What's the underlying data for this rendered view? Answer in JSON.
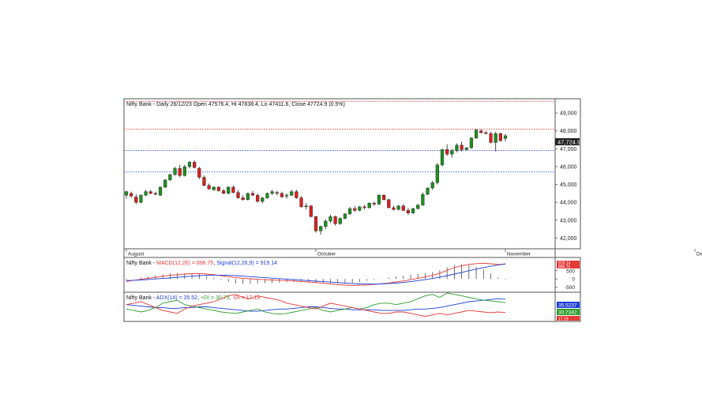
{
  "chart_data": [
    {
      "type": "candlestick",
      "title": "Nifty Bank - Daily 26/12/23 Open 47576.4, Hi 47838.4, Lo 47411.6, Close 47724.9 (0.5%)",
      "y_ticks": [
        42000,
        43000,
        44000,
        45000,
        46000,
        47000,
        48000,
        49000
      ],
      "y_tick_labels": [
        "42,000",
        "43,000",
        "44,000",
        "45,000",
        "46,000",
        "47,000",
        "48,000",
        "49,000"
      ],
      "ylim": [
        41400,
        49800
      ],
      "x_labels": [
        {
          "label": "August",
          "index": 0
        },
        {
          "label": "October",
          "index": 39
        },
        {
          "label": "November",
          "index": 78
        },
        {
          "label": "December",
          "index": 117
        }
      ],
      "last_value_label": "47,724.9",
      "horizontal_lines": [
        {
          "value": 49650,
          "color": "#e53935"
        },
        {
          "value": 48100,
          "color": "#e53935"
        },
        {
          "value": 46900,
          "color": "#1e3fd8"
        },
        {
          "value": 45700,
          "color": "#1e3fd8"
        }
      ],
      "candles": [
        {
          "o": 44400,
          "h": 44650,
          "l": 44200,
          "c": 44600
        },
        {
          "o": 44500,
          "h": 44600,
          "l": 44250,
          "c": 44350
        },
        {
          "o": 44300,
          "h": 44450,
          "l": 43900,
          "c": 44000
        },
        {
          "o": 44000,
          "h": 44450,
          "l": 43950,
          "c": 44400
        },
        {
          "o": 44400,
          "h": 44700,
          "l": 44350,
          "c": 44600
        },
        {
          "o": 44600,
          "h": 44700,
          "l": 44450,
          "c": 44500
        },
        {
          "o": 44500,
          "h": 44600,
          "l": 44400,
          "c": 44450
        },
        {
          "o": 44400,
          "h": 44900,
          "l": 44350,
          "c": 44850
        },
        {
          "o": 44850,
          "h": 45300,
          "l": 44800,
          "c": 45250
        },
        {
          "o": 45250,
          "h": 45600,
          "l": 45200,
          "c": 45550
        },
        {
          "o": 45550,
          "h": 46000,
          "l": 45500,
          "c": 45900
        },
        {
          "o": 45900,
          "h": 46100,
          "l": 45400,
          "c": 45500
        },
        {
          "o": 45500,
          "h": 46100,
          "l": 45450,
          "c": 46000
        },
        {
          "o": 46000,
          "h": 46300,
          "l": 45900,
          "c": 46250
        },
        {
          "o": 46250,
          "h": 46350,
          "l": 45900,
          "c": 45950
        },
        {
          "o": 45900,
          "h": 46000,
          "l": 45300,
          "c": 45400
        },
        {
          "o": 45400,
          "h": 45500,
          "l": 44900,
          "c": 44950
        },
        {
          "o": 44950,
          "h": 45050,
          "l": 44700,
          "c": 44750
        },
        {
          "o": 44700,
          "h": 44900,
          "l": 44650,
          "c": 44850
        },
        {
          "o": 44850,
          "h": 44900,
          "l": 44600,
          "c": 44650
        },
        {
          "o": 44650,
          "h": 44750,
          "l": 44450,
          "c": 44500
        },
        {
          "o": 44500,
          "h": 44900,
          "l": 44450,
          "c": 44850
        },
        {
          "o": 44850,
          "h": 44950,
          "l": 44500,
          "c": 44550
        },
        {
          "o": 44550,
          "h": 44700,
          "l": 44200,
          "c": 44250
        },
        {
          "o": 44250,
          "h": 44400,
          "l": 44100,
          "c": 44150
        },
        {
          "o": 44150,
          "h": 44550,
          "l": 44100,
          "c": 44500
        },
        {
          "o": 44500,
          "h": 44650,
          "l": 44350,
          "c": 44400
        },
        {
          "o": 44400,
          "h": 44500,
          "l": 44000,
          "c": 44050
        },
        {
          "o": 44050,
          "h": 44300,
          "l": 43950,
          "c": 44250
        },
        {
          "o": 44250,
          "h": 44550,
          "l": 44200,
          "c": 44500
        },
        {
          "o": 44500,
          "h": 44700,
          "l": 44400,
          "c": 44600
        },
        {
          "o": 44550,
          "h": 44650,
          "l": 44400,
          "c": 44500
        },
        {
          "o": 44500,
          "h": 44600,
          "l": 44250,
          "c": 44300
        },
        {
          "o": 44350,
          "h": 44500,
          "l": 44200,
          "c": 44400
        },
        {
          "o": 44400,
          "h": 44700,
          "l": 44350,
          "c": 44600
        },
        {
          "o": 44600,
          "h": 44700,
          "l": 44200,
          "c": 44250
        },
        {
          "o": 44250,
          "h": 44350,
          "l": 43700,
          "c": 43750
        },
        {
          "o": 43750,
          "h": 43950,
          "l": 43600,
          "c": 43800
        },
        {
          "o": 43800,
          "h": 43850,
          "l": 43150,
          "c": 43200
        },
        {
          "o": 43200,
          "h": 43250,
          "l": 42300,
          "c": 42400
        },
        {
          "o": 42400,
          "h": 42700,
          "l": 42200,
          "c": 42650
        },
        {
          "o": 42650,
          "h": 43050,
          "l": 42500,
          "c": 42950
        },
        {
          "o": 42950,
          "h": 43300,
          "l": 42850,
          "c": 43200
        },
        {
          "o": 43200,
          "h": 43250,
          "l": 42700,
          "c": 42800
        },
        {
          "o": 42800,
          "h": 43150,
          "l": 42750,
          "c": 43100
        },
        {
          "o": 43100,
          "h": 43400,
          "l": 43050,
          "c": 43350
        },
        {
          "o": 43350,
          "h": 43750,
          "l": 43300,
          "c": 43650
        },
        {
          "o": 43650,
          "h": 43800,
          "l": 43450,
          "c": 43550
        },
        {
          "o": 43550,
          "h": 43800,
          "l": 43500,
          "c": 43750
        },
        {
          "o": 43750,
          "h": 43850,
          "l": 43600,
          "c": 43700
        },
        {
          "o": 43700,
          "h": 44000,
          "l": 43650,
          "c": 43950
        },
        {
          "o": 43950,
          "h": 44050,
          "l": 43800,
          "c": 43900
        },
        {
          "o": 43900,
          "h": 44450,
          "l": 43850,
          "c": 44400
        },
        {
          "o": 44400,
          "h": 44450,
          "l": 44100,
          "c": 44150
        },
        {
          "o": 44150,
          "h": 44200,
          "l": 43650,
          "c": 43700
        },
        {
          "o": 43700,
          "h": 43800,
          "l": 43550,
          "c": 43600
        },
        {
          "o": 43600,
          "h": 43850,
          "l": 43550,
          "c": 43800
        },
        {
          "o": 43800,
          "h": 43900,
          "l": 43500,
          "c": 43550
        },
        {
          "o": 43550,
          "h": 43700,
          "l": 43300,
          "c": 43400
        },
        {
          "o": 43400,
          "h": 43700,
          "l": 43350,
          "c": 43650
        },
        {
          "o": 43650,
          "h": 43900,
          "l": 43600,
          "c": 43850
        },
        {
          "o": 43850,
          "h": 44550,
          "l": 43800,
          "c": 44450
        },
        {
          "o": 44450,
          "h": 44850,
          "l": 44400,
          "c": 44800
        },
        {
          "o": 44800,
          "h": 45200,
          "l": 44700,
          "c": 45100
        },
        {
          "o": 45100,
          "h": 46200,
          "l": 45000,
          "c": 46100
        },
        {
          "o": 46100,
          "h": 47000,
          "l": 46000,
          "c": 46950
        },
        {
          "o": 46950,
          "h": 47250,
          "l": 46600,
          "c": 46700
        },
        {
          "o": 46700,
          "h": 47000,
          "l": 46500,
          "c": 46900
        },
        {
          "o": 46900,
          "h": 47300,
          "l": 46800,
          "c": 47200
        },
        {
          "o": 47200,
          "h": 47400,
          "l": 46850,
          "c": 46950
        },
        {
          "o": 46950,
          "h": 47100,
          "l": 46900,
          "c": 47050
        },
        {
          "o": 47050,
          "h": 47650,
          "l": 47000,
          "c": 47600
        },
        {
          "o": 47600,
          "h": 48100,
          "l": 47550,
          "c": 48050
        },
        {
          "o": 48000,
          "h": 48100,
          "l": 47850,
          "c": 47900
        },
        {
          "o": 47900,
          "h": 48000,
          "l": 47800,
          "c": 47850
        },
        {
          "o": 47850,
          "h": 47950,
          "l": 47300,
          "c": 47350
        },
        {
          "o": 47350,
          "h": 47950,
          "l": 46850,
          "c": 47850
        },
        {
          "o": 47850,
          "h": 47900,
          "l": 47400,
          "c": 47450
        },
        {
          "o": 47576.4,
          "h": 47838.4,
          "l": 47411.6,
          "c": 47724.9
        }
      ]
    },
    {
      "type": "line",
      "title": "Nifty Bank - MACD(12,26) = 896.75, Signal(12,26,9) = 919.14",
      "title_parts": [
        "Nifty Bank - ",
        "MACD(12,26) = 896.75",
        ", ",
        "Signal(12,26,9) = 919.14"
      ],
      "y_ticks": [
        -500,
        0,
        500
      ],
      "y_tick_labels": [
        "-500",
        "0",
        "500"
      ],
      "ylim": [
        -800,
        1300
      ],
      "value_flags": [
        "919.14",
        "896.75"
      ],
      "series": [
        {
          "name": "MACD(12,26)",
          "color": "#e53935",
          "values": [
            -150,
            -80,
            -20,
            40,
            100,
            160,
            220,
            260,
            300,
            320,
            330,
            300,
            260,
            200,
            140,
            80,
            40,
            10,
            -20,
            -40,
            -60,
            -80,
            -100,
            -120,
            -150,
            -180,
            -220,
            -260,
            -300,
            -340,
            -370,
            -390,
            -380,
            -360,
            -330,
            -290,
            -240,
            -180,
            -120,
            -40,
            40,
            120,
            220,
            350,
            520,
            680,
            800,
            880,
            930,
            950,
            920,
            880,
            896.75
          ]
        },
        {
          "name": "Signal(12,26,9)",
          "color": "#1e3fd8",
          "values": [
            -100,
            -80,
            -60,
            -30,
            0,
            30,
            60,
            100,
            140,
            170,
            200,
            220,
            230,
            230,
            220,
            200,
            170,
            140,
            110,
            80,
            50,
            20,
            -10,
            -40,
            -70,
            -100,
            -130,
            -160,
            -190,
            -220,
            -250,
            -280,
            -300,
            -310,
            -310,
            -300,
            -280,
            -250,
            -210,
            -160,
            -100,
            -40,
            30,
            110,
            200,
            300,
            400,
            500,
            600,
            690,
            770,
            840,
            919.14
          ]
        }
      ],
      "histogram_color": "#333333"
    },
    {
      "type": "line",
      "title": "Nifty Bank - ADX(14) = 35.52, +DI = 30.73, -DI = 17.19",
      "title_parts": [
        "Nifty Bank - ",
        "ADX(14) = 35.52",
        ", ",
        "+DI = 30.73",
        ", ",
        "-DI = 17.19"
      ],
      "ylim": [
        5,
        45
      ],
      "value_flags": [
        "35.5237",
        "30.7342",
        "17.19"
      ],
      "series": [
        {
          "name": "ADX(14)",
          "color": "#1e3fd8",
          "values": [
            28,
            27,
            26,
            25,
            24,
            24,
            23,
            23,
            24,
            24,
            25,
            25,
            24,
            23,
            22,
            21,
            20,
            19,
            19,
            20,
            21,
            22,
            22,
            23,
            24,
            25,
            25,
            24,
            23,
            22,
            22,
            21,
            21,
            21,
            21,
            20,
            20,
            20,
            20,
            21,
            22,
            22,
            23,
            24,
            26,
            28,
            30,
            32,
            33,
            34,
            35,
            36,
            35.52
          ]
        },
        {
          "name": "+DI",
          "color": "#2e9e2e",
          "values": [
            22,
            20,
            18,
            20,
            24,
            30,
            32,
            34,
            28,
            26,
            24,
            22,
            20,
            18,
            17,
            16,
            18,
            20,
            22,
            18,
            16,
            15,
            16,
            18,
            20,
            22,
            24,
            20,
            18,
            20,
            22,
            24,
            22,
            24,
            28,
            30,
            30,
            28,
            30,
            32,
            36,
            40,
            42,
            38,
            44,
            42,
            40,
            38,
            36,
            34,
            33,
            32,
            30.73
          ]
        },
        {
          "name": "-DI",
          "color": "#e53935",
          "values": [
            28,
            30,
            32,
            28,
            24,
            20,
            18,
            16,
            22,
            26,
            28,
            30,
            32,
            36,
            40,
            42,
            38,
            36,
            40,
            38,
            36,
            34,
            30,
            28,
            26,
            24,
            22,
            26,
            30,
            28,
            26,
            24,
            22,
            20,
            18,
            16,
            16,
            18,
            18,
            16,
            14,
            12,
            14,
            16,
            14,
            16,
            18,
            20,
            19,
            18,
            17,
            18,
            17.19
          ]
        }
      ]
    }
  ]
}
